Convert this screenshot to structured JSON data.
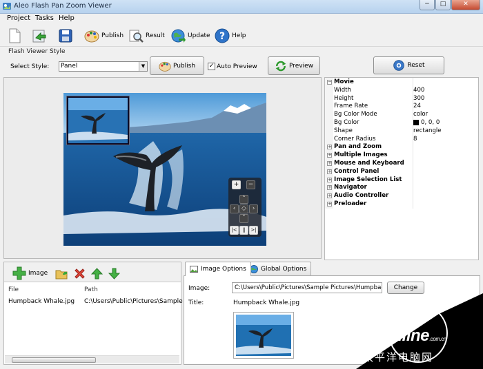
{
  "window": {
    "title": "Aleo Flash Pan Zoom Viewer",
    "minimize": "─",
    "maximize": "□",
    "close": "✕"
  },
  "menu": [
    "Project",
    "Tasks",
    "Help"
  ],
  "toolbar": {
    "new_icon": "new-file-icon",
    "items": [
      {
        "label": "Publish",
        "icon": "palette-icon"
      },
      {
        "label": "Result",
        "icon": "magnifier-icon"
      },
      {
        "label": "Update",
        "icon": "globe-icon"
      },
      {
        "label": "Help",
        "icon": "help-icon"
      }
    ]
  },
  "style_section": {
    "title": "Flash Viewer Style",
    "select_label": "Select Style:",
    "select_value": "Panel",
    "publish_label": "Publish",
    "auto_preview_label": "Auto Preview",
    "auto_preview_checked": "✓",
    "preview_label": "Preview"
  },
  "reset_label": "Reset",
  "properties": [
    {
      "name": "Movie",
      "value": "",
      "kind": "category",
      "expand": "−"
    },
    {
      "name": "Width",
      "value": "400"
    },
    {
      "name": "Height",
      "value": "300"
    },
    {
      "name": "Frame Rate",
      "value": "24"
    },
    {
      "name": "Bg Color Mode",
      "value": "color"
    },
    {
      "name": "Bg Color",
      "value": "0, 0, 0",
      "swatch": "#000000"
    },
    {
      "name": "Shape",
      "value": "rectangle"
    },
    {
      "name": "Corner Radius",
      "value": "8"
    },
    {
      "name": "Pan and Zoom",
      "value": "",
      "kind": "category",
      "expand": "+"
    },
    {
      "name": "Multiple Images",
      "value": "",
      "kind": "category",
      "expand": "+"
    },
    {
      "name": "Mouse and Keyboard",
      "value": "",
      "kind": "category",
      "expand": "+"
    },
    {
      "name": "Control Panel",
      "value": "",
      "kind": "category",
      "expand": "+"
    },
    {
      "name": "Image Selection List",
      "value": "",
      "kind": "category",
      "expand": "+"
    },
    {
      "name": "Navigator",
      "value": "",
      "kind": "category",
      "expand": "+"
    },
    {
      "name": "Audio Controller",
      "value": "",
      "kind": "category",
      "expand": "+"
    },
    {
      "name": "Preloader",
      "value": "",
      "kind": "category",
      "expand": "+"
    }
  ],
  "image_list": {
    "add_label": "Image",
    "columns": [
      "File",
      "Path"
    ],
    "rows": [
      {
        "file": "Humpback Whale.jpg",
        "path": "C:\\Users\\Public\\Pictures\\Sample"
      }
    ]
  },
  "image_tabs": [
    "Image Options",
    "Global Options"
  ],
  "image_options": {
    "image_label": "Image:",
    "image_value": "C:\\Users\\Public\\Pictures\\Sample Pictures\\Humpback",
    "change_label": "Change",
    "title_label": "Title:",
    "title_value": "Humpback Whale.jpg"
  },
  "viewer_controls": {
    "zoom_in": "+",
    "zoom_out": "−",
    "up": "˄",
    "down": "˅",
    "left": "‹",
    "right": "›",
    "center": "◇",
    "first": "|<",
    "pause": "||",
    "last": ">|"
  },
  "watermark": {
    "brand": "PConline",
    "domain": ".com.cn",
    "tagline": "太平洋电脑网"
  },
  "colors": {
    "accent": "#2f6fb0",
    "sea": "#1d5f9e",
    "sky": "#5aa2dd",
    "title_text": "#1e2e44"
  }
}
